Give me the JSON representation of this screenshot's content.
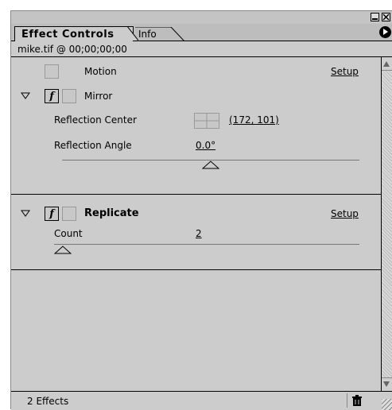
{
  "panel": {
    "tabs": [
      {
        "label": "Effect Controls",
        "active": true
      },
      {
        "label": "Info",
        "active": false
      }
    ],
    "clip_label": "mike.tif @ 00;00;00;00"
  },
  "effects": {
    "motion": {
      "name": "Motion",
      "setup_label": "Setup"
    },
    "mirror": {
      "name": "Mirror",
      "fx_glyph": "f",
      "reflection_center_label": "Reflection Center",
      "reflection_center_value": "(172, 101)",
      "reflection_angle_label": "Reflection Angle",
      "reflection_angle_value": "0.0°"
    },
    "replicate": {
      "name": "Replicate",
      "fx_glyph": "f",
      "setup_label": "Setup",
      "count_label": "Count",
      "count_value": "2"
    }
  },
  "status": {
    "effects_count": "2 Effects"
  },
  "colors": {
    "panel_bg": "#cccccc",
    "border": "#000000"
  }
}
